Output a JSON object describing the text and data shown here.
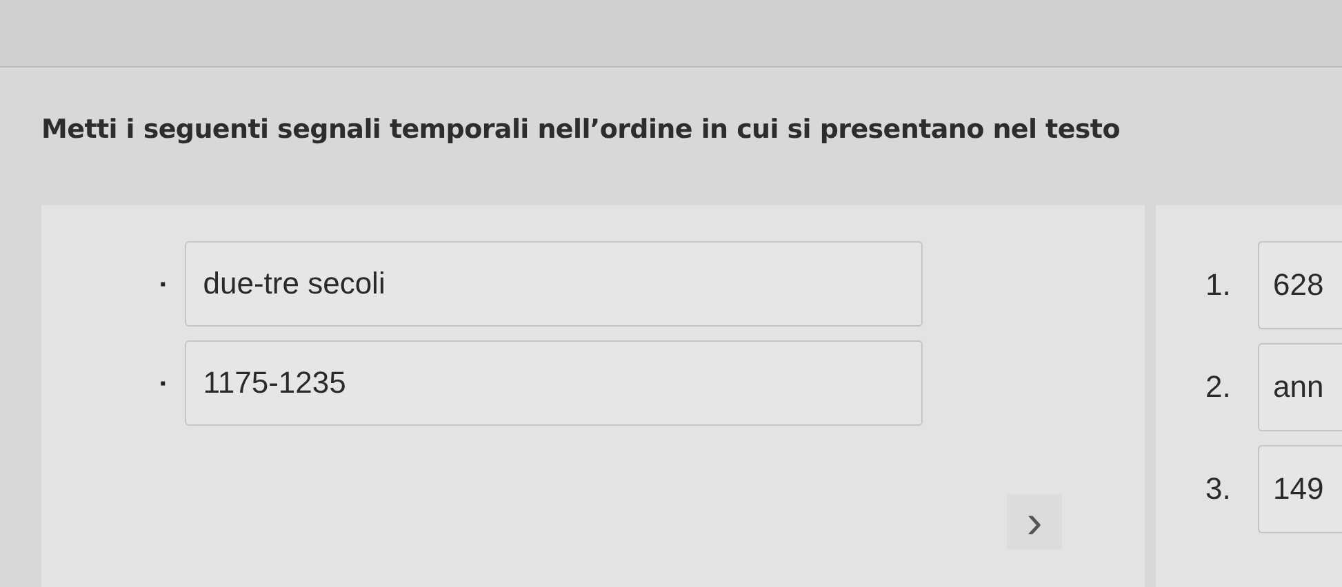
{
  "instruction": "Metti i seguenti segnali temporali nell’ordine in cui si presentano nel testo",
  "source_items": [
    {
      "marker": "▪",
      "text": "due-tre secoli"
    },
    {
      "marker": "▪",
      "text": "1175-1235"
    }
  ],
  "next_arrow": "›",
  "ordered_slots": [
    {
      "number": "1.",
      "text": "628"
    },
    {
      "number": "2.",
      "text": "ann"
    },
    {
      "number": "3.",
      "text": "149"
    }
  ]
}
